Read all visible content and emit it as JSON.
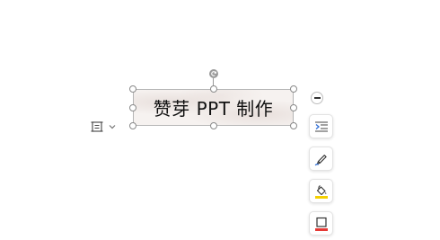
{
  "textbox": {
    "text": "赞芽 PPT 制作"
  },
  "icons": {
    "layout": "text-layout-icon",
    "layout_dropdown": "chevron-down-icon",
    "rotate": "rotate-icon",
    "collapse": "minus-icon",
    "text_style": "text-style-icon",
    "outline": "pen-outline-icon",
    "fill": "fill-bucket-icon",
    "border_color": "border-color-icon"
  },
  "colors": {
    "accent_blue": "#2f6fd6",
    "fill_yellow": "#f5d000",
    "border_red": "#e53935"
  }
}
